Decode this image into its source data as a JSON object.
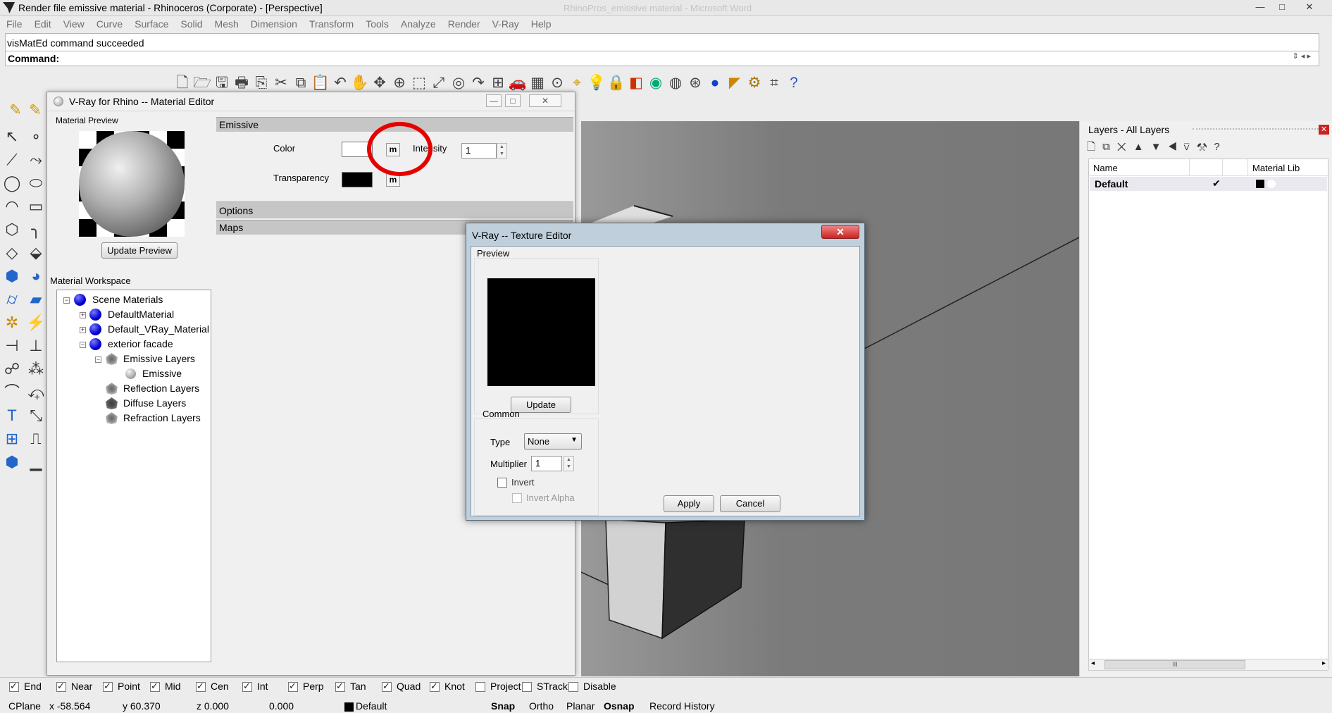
{
  "app": {
    "title": "Render file emissive material - Rhinoceros (Corporate) - [Perspective]",
    "background_window_title": "RhinoPros_emissive material - Microsoft Word",
    "window_buttons": [
      "—",
      "□",
      "✕"
    ]
  },
  "menu": [
    "File",
    "Edit",
    "View",
    "Curve",
    "Surface",
    "Solid",
    "Mesh",
    "Dimension",
    "Transform",
    "Tools",
    "Analyze",
    "Render",
    "V-Ray",
    "Help"
  ],
  "command": {
    "history": "visMatEd command succeeded",
    "prompt": "Command:"
  },
  "toolbar_icons": [
    "new-file-icon",
    "open-file-icon",
    "save-icon",
    "print-icon",
    "import-icon",
    "cut-icon",
    "copy-icon",
    "paste-icon",
    "undo-icon",
    "pan-icon",
    "rotate-view-icon",
    "zoom-icon",
    "zoom-window-icon",
    "zoom-extents-icon",
    "zoom-selected-icon",
    "redo-view-icon",
    "four-viewports-icon",
    "car-icon",
    "grid-icon",
    "point-icon",
    "osnap-icon",
    "light-bulb-icon",
    "lock-icon",
    "layer-icon",
    "color-wheel-icon",
    "sphere-wire-icon",
    "sphere-mesh-icon",
    "render-sphere-icon",
    "render-setup-icon",
    "gear-icon",
    "dimension-icon",
    "help-icon"
  ],
  "material_editor": {
    "title": "V-Ray for Rhino -- Material Editor",
    "preview_label": "Material Preview",
    "update_preview": "Update Preview",
    "workspace_label": "Material Workspace",
    "tree": {
      "root": "Scene Materials",
      "items": [
        "DefaultMaterial",
        "Default_VRay_Material",
        "exterior facade"
      ],
      "layers": [
        "Emissive Layers",
        "Reflection Layers",
        "Diffuse Layers",
        "Refraction Layers"
      ],
      "emissive_child": "Emissive"
    },
    "sections": {
      "emissive": "Emissive",
      "options": "Options",
      "maps": "Maps"
    },
    "color_label": "Color",
    "intensity_label": "Intensity",
    "intensity_value": "1",
    "transparency_label": "Transparency",
    "m_label": "m",
    "color_swatch": "#ffffff",
    "transparency_swatch": "#000000"
  },
  "texture_editor": {
    "title": "V-Ray -- Texture Editor",
    "close": "✕",
    "preview_label": "Preview",
    "update": "Update",
    "common_label": "Common",
    "type_label": "Type",
    "type_value": "None",
    "multiplier_label": "Multiplier",
    "multiplier_value": "1",
    "invert": "Invert",
    "invert_alpha": "Invert Alpha",
    "apply": "Apply",
    "cancel": "Cancel"
  },
  "layers": {
    "title": "Layers - All Layers",
    "col_name": "Name",
    "col_material": "Material Lib",
    "row_name": "Default",
    "row_check": "✔",
    "scroll_thumb": "III"
  },
  "osnaps": [
    {
      "label": "End",
      "checked": true
    },
    {
      "label": "Near",
      "checked": true
    },
    {
      "label": "Point",
      "checked": true
    },
    {
      "label": "Mid",
      "checked": true
    },
    {
      "label": "Cen",
      "checked": true
    },
    {
      "label": "Int",
      "checked": true
    },
    {
      "label": "Perp",
      "checked": true
    },
    {
      "label": "Tan",
      "checked": true
    },
    {
      "label": "Quad",
      "checked": true
    },
    {
      "label": "Knot",
      "checked": true
    },
    {
      "label": "Project",
      "checked": false
    },
    {
      "label": "STrack",
      "checked": false
    },
    {
      "label": "Disable",
      "checked": false
    }
  ],
  "status": {
    "cplane": "CPlane",
    "x": "x -58.564",
    "y": "y 60.370",
    "z": "z 0.000",
    "w": "0.000",
    "layer": "Default",
    "snap": "Snap",
    "ortho": "Ortho",
    "planar": "Planar",
    "osnap": "Osnap",
    "record_history": "Record History"
  },
  "colors": {
    "highlight_ring": "#e60000",
    "material_dot": "#0000d0"
  }
}
